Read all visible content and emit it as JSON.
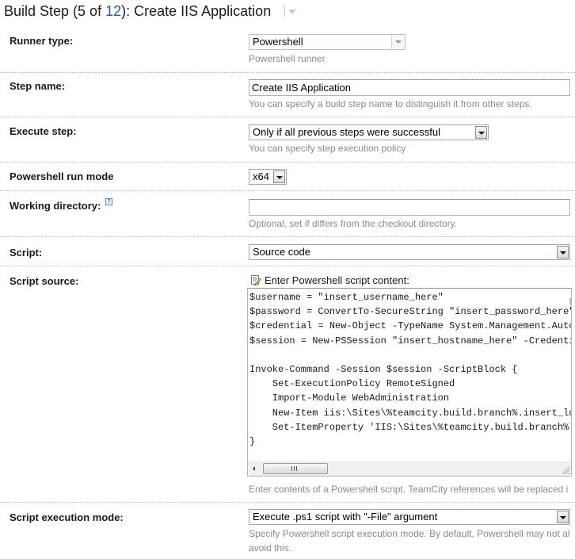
{
  "header": {
    "prefix": "Build Step (5 of ",
    "total_steps_link": "12",
    "suffix": "): Create IIS Application",
    "menu_icon": "chevron-down-icon"
  },
  "fields": {
    "runner_type": {
      "label": "Runner type:",
      "value": "Powershell",
      "hint": "Powershell runner"
    },
    "step_name": {
      "label": "Step name:",
      "value": "Create IIS Application",
      "hint": "You can specify a build step name to distinguish it from other steps."
    },
    "execute_step": {
      "label": "Execute step:",
      "value": "Only if all previous steps were successful",
      "hint": "You can specify step execution policy"
    },
    "run_mode": {
      "label": "Powershell run mode",
      "value": "x64"
    },
    "working_directory": {
      "label": "Working directory:",
      "help_icon": "help-icon",
      "help_glyph": "?",
      "value": "",
      "hint": "Optional, set if differs from the checkout directory."
    },
    "script": {
      "label": "Script:",
      "value": "Source code"
    },
    "script_source": {
      "label": "Script source:",
      "caption": "Enter Powershell script content:",
      "caption_icon": "edit-document-icon",
      "code_lines": [
        "$username = \"insert_username_here\"",
        "$password = ConvertTo-SecureString \"insert_password_here\" ",
        "$credential = New-Object -TypeName System.Management.Autom",
        "$session = New-PSSession \"insert_hostname_here\" -Credentia",
        "",
        "Invoke-Command -Session $session -ScriptBlock {",
        "    Set-ExecutionPolicy RemoteSigned",
        "    Import-Module WebAdministration",
        "    New-Item iis:\\Sites\\%teamcity.build.branch%.insert_loc",
        "    Set-ItemProperty 'IIS:\\Sites\\%teamcity.build.branch%.i",
        "}"
      ],
      "hint": "Enter contents of a Powershell script. TeamCity references will be replaced i"
    },
    "execution_mode": {
      "label": "Script execution mode:",
      "value": "Execute .ps1 script with \"-File\" argument",
      "hint_line1": "Specify Powershell script execution mode. By default, Powershell may not al",
      "hint_line2": "avoid this."
    }
  }
}
